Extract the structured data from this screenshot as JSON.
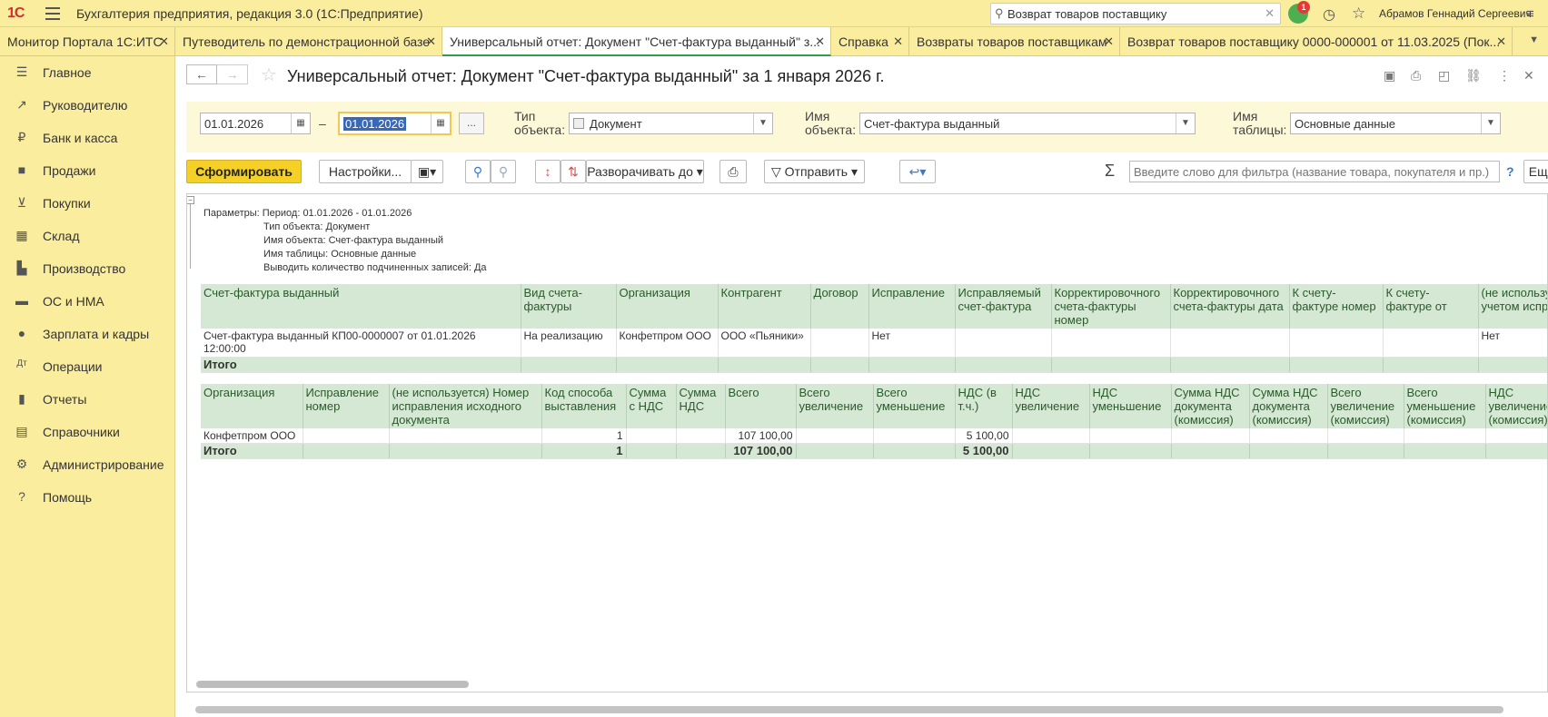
{
  "app": {
    "title": "Бухгалтерия предприятия, редакция 3.0  (1С:Предприятие)",
    "logo": "1С",
    "search_value": "Возврат товаров поставщику",
    "notifications_count": "1",
    "user": "Абрамов Геннадий Сергеевич"
  },
  "tabs": [
    {
      "label": "Монитор Портала 1С:ИТС"
    },
    {
      "label": "Путеводитель по демонстрационной базе"
    },
    {
      "label": "Универсальный отчет: Документ \"Счет-фактура выданный\" з..."
    },
    {
      "label": "Справка"
    },
    {
      "label": "Возвраты товаров поставщикам"
    },
    {
      "label": "Возврат товаров поставщику 0000-000001 от 11.03.2025 (Пок..."
    }
  ],
  "sidebar": {
    "items": [
      {
        "label": "Главное",
        "icon": "menu-icon"
      },
      {
        "label": "Руководителю",
        "icon": "trend-icon"
      },
      {
        "label": "Банк и касса",
        "icon": "ruble-icon"
      },
      {
        "label": "Продажи",
        "icon": "bag-icon"
      },
      {
        "label": "Покупки",
        "icon": "cart-icon"
      },
      {
        "label": "Склад",
        "icon": "warehouse-icon"
      },
      {
        "label": "Производство",
        "icon": "factory-icon"
      },
      {
        "label": "ОС и НМА",
        "icon": "truck-icon"
      },
      {
        "label": "Зарплата и кадры",
        "icon": "person-icon"
      },
      {
        "label": "Операции",
        "icon": "operations-icon"
      },
      {
        "label": "Отчеты",
        "icon": "chart-icon"
      },
      {
        "label": "Справочники",
        "icon": "book-icon"
      },
      {
        "label": "Администрирование",
        "icon": "gear-icon"
      },
      {
        "label": "Помощь",
        "icon": "help-icon"
      }
    ]
  },
  "page": {
    "title": "Универсальный отчет: Документ \"Счет-фактура выданный\" за 1 января 2026 г."
  },
  "params": {
    "date_from": "01.01.2026",
    "date_to": "01.01.2026",
    "dash": "–",
    "dots": "...",
    "object_type_label": "Тип объекта:",
    "object_type_value": "Документ",
    "object_name_label": "Имя объекта:",
    "object_name_value": "Счет-фактура выданный",
    "table_name_label": "Имя таблицы:",
    "table_name_value": "Основные данные"
  },
  "toolbar": {
    "run": "Сформировать",
    "settings": "Настройки...",
    "expand": "Разворачивать до",
    "send": "Отправить",
    "filter_placeholder": "Введите слово для фильтра (название товара, покупателя и пр.)",
    "more": "Еще",
    "help": "?"
  },
  "report": {
    "param_lines": [
      "Параметры: Период: 01.01.2026 - 01.01.2026",
      "Тип объекта: Документ",
      "Имя объекта: Счет-фактура выданный",
      "Имя таблицы: Основные данные",
      "Выводить количество подчиненных записей: Да"
    ],
    "table1": {
      "headers": [
        "Счет-фактура выданный",
        "Вид счета-фактуры",
        "Организация",
        "Контрагент",
        "Договор",
        "Исправление",
        "Исправляемый счет-фактура",
        "Корректировочного счета-фактуры номер",
        "Корректировочного счета-фактуры дата",
        "К счету-фактуре номер",
        "К счету-фактуре от",
        "(не использу учетом испра"
      ],
      "rows": [
        [
          "Счет-фактура выданный КП00-0000007 от 01.01.2026 12:00:00",
          "На реализацию",
          "Конфетпром ООО",
          "ООО «Пьяники»",
          "",
          "Нет",
          "",
          "",
          "",
          "",
          "",
          "Нет"
        ]
      ],
      "total_label": "Итого"
    },
    "table2": {
      "headers": [
        "Организация",
        "Исправление номер",
        "(не используется) Номер исправления исходного документа",
        "Код способа выставления",
        "Сумма с НДС",
        "Сумма НДС",
        "Всего",
        "Всего увеличение",
        "Всего уменьшение",
        "НДС (в т.ч.)",
        "НДС увеличение",
        "НДС уменьшение",
        "Сумма НДС документа (комиссия)",
        "Сумма НДС документа (комиссия)",
        "Всего увеличение (комиссия)",
        "Всего уменьшение (комиссия)",
        "НДС увеличение (комиссия)"
      ],
      "rows": [
        [
          "Конфетпром ООО",
          "",
          "",
          "1",
          "",
          "",
          "107 100,00",
          "",
          "",
          "5 100,00",
          "",
          "",
          "",
          "",
          "",
          "",
          ""
        ]
      ],
      "total": [
        "Итого",
        "",
        "",
        "1",
        "",
        "",
        "107 100,00",
        "",
        "",
        "5 100,00",
        "",
        "",
        "",
        "",
        "",
        "",
        ""
      ]
    }
  }
}
